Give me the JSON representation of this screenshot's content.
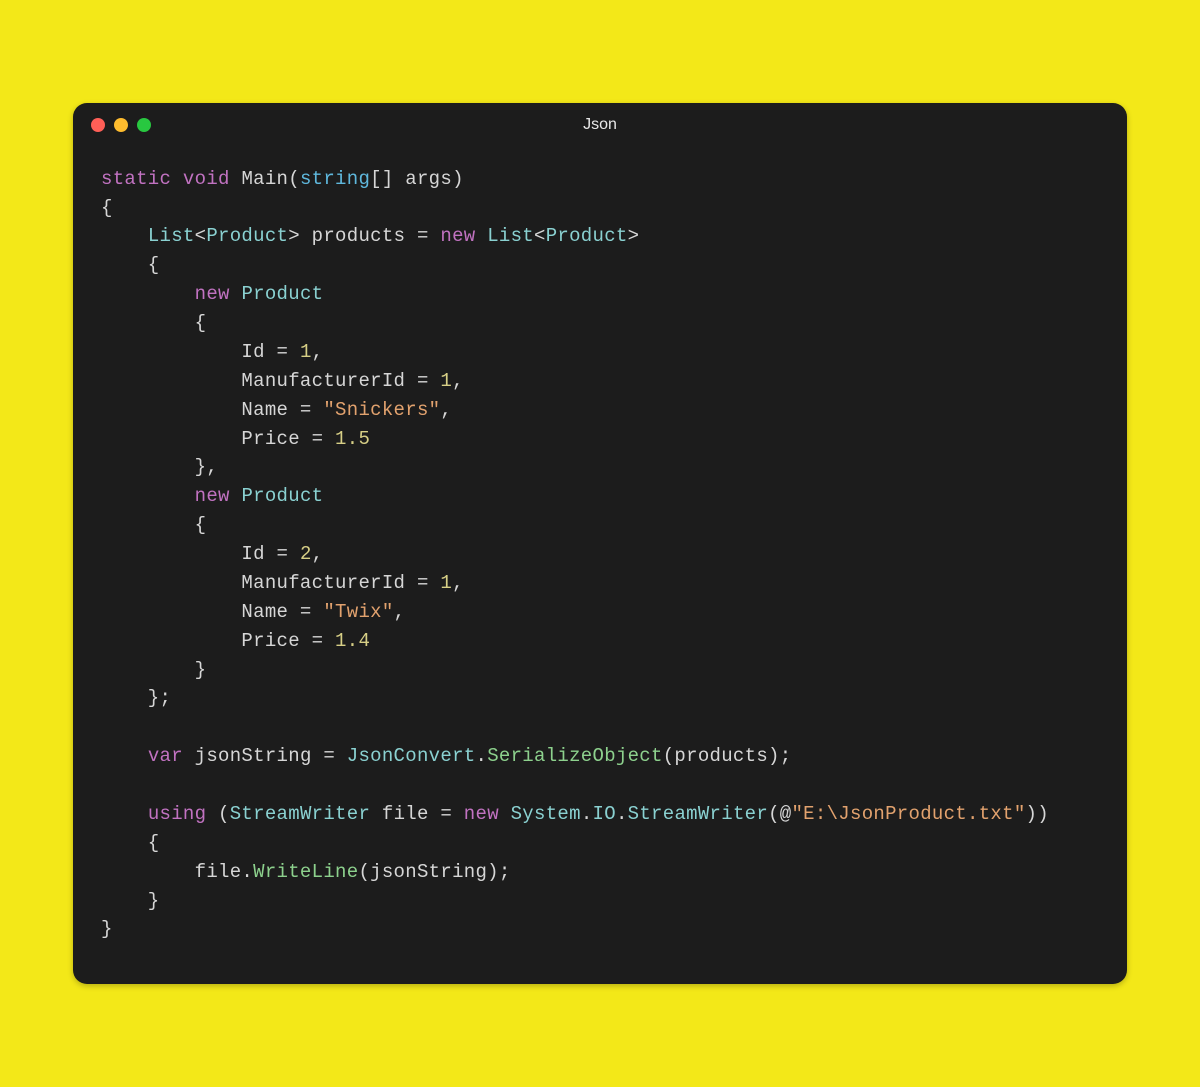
{
  "window": {
    "title": "Json"
  },
  "code": {
    "l01": {
      "a": "static",
      "b": "void",
      "c": "Main",
      "d": "(",
      "e": "string",
      "f": "[] args)"
    },
    "l02": "{",
    "l03": {
      "a": "    ",
      "b": "List",
      "c": "<",
      "d": "Product",
      "e": "> products = ",
      "f": "new",
      "g": " ",
      "h": "List",
      "i": "<",
      "j": "Product",
      "k": ">"
    },
    "l04": "    {",
    "l05": {
      "a": "        ",
      "b": "new",
      "c": " ",
      "d": "Product"
    },
    "l06": "        {",
    "l07": {
      "a": "            Id = ",
      "b": "1",
      "c": ","
    },
    "l08": {
      "a": "            ManufacturerId = ",
      "b": "1",
      "c": ","
    },
    "l09": {
      "a": "            Name = ",
      "b": "\"Snickers\"",
      "c": ","
    },
    "l10": {
      "a": "            Price = ",
      "b": "1.5"
    },
    "l11": "        },",
    "l12": {
      "a": "        ",
      "b": "new",
      "c": " ",
      "d": "Product"
    },
    "l13": "        {",
    "l14": {
      "a": "            Id = ",
      "b": "2",
      "c": ","
    },
    "l15": {
      "a": "            ManufacturerId = ",
      "b": "1",
      "c": ","
    },
    "l16": {
      "a": "            Name = ",
      "b": "\"Twix\"",
      "c": ","
    },
    "l17": {
      "a": "            Price = ",
      "b": "1.4"
    },
    "l18": "        }",
    "l19": "    };",
    "l20": "",
    "l21": {
      "a": "    ",
      "b": "var",
      "c": " jsonString = ",
      "d": "JsonConvert",
      "e": ".",
      "f": "SerializeObject",
      "g": "(products);"
    },
    "l22": "",
    "l23": {
      "a": "    ",
      "b": "using",
      "c": " (",
      "d": "StreamWriter",
      "e": " file = ",
      "f": "new",
      "g": " ",
      "h": "System",
      "i": ".",
      "j": "IO",
      "k": ".",
      "l": "StreamWriter",
      "m": "(@",
      "n": "\"E:\\JsonProduct.txt\"",
      "o": "))"
    },
    "l24": "    {",
    "l25": {
      "a": "        file.",
      "b": "WriteLine",
      "c": "(jsonString);"
    },
    "l26": "    }",
    "l27": "}"
  }
}
